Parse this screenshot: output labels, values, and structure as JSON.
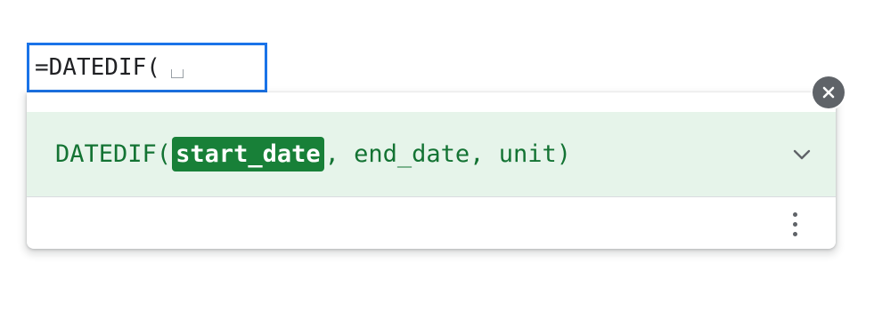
{
  "cell_editor": {
    "formula": "=DATEDIF("
  },
  "formula_help": {
    "signature": {
      "function_name": "DATEDIF",
      "open_paren": "(",
      "active_arg": "start_date",
      "rest": ", end_date, unit)"
    },
    "expand_icon": "chevron-down-icon",
    "more_icon": "more-vert-icon",
    "close_icon": "close-icon"
  },
  "colors": {
    "selection_border": "#1a73e8",
    "signature_bg": "#e6f4ea",
    "signature_text": "#137333",
    "active_arg_bg": "#188038",
    "close_bg": "#5f6368"
  }
}
